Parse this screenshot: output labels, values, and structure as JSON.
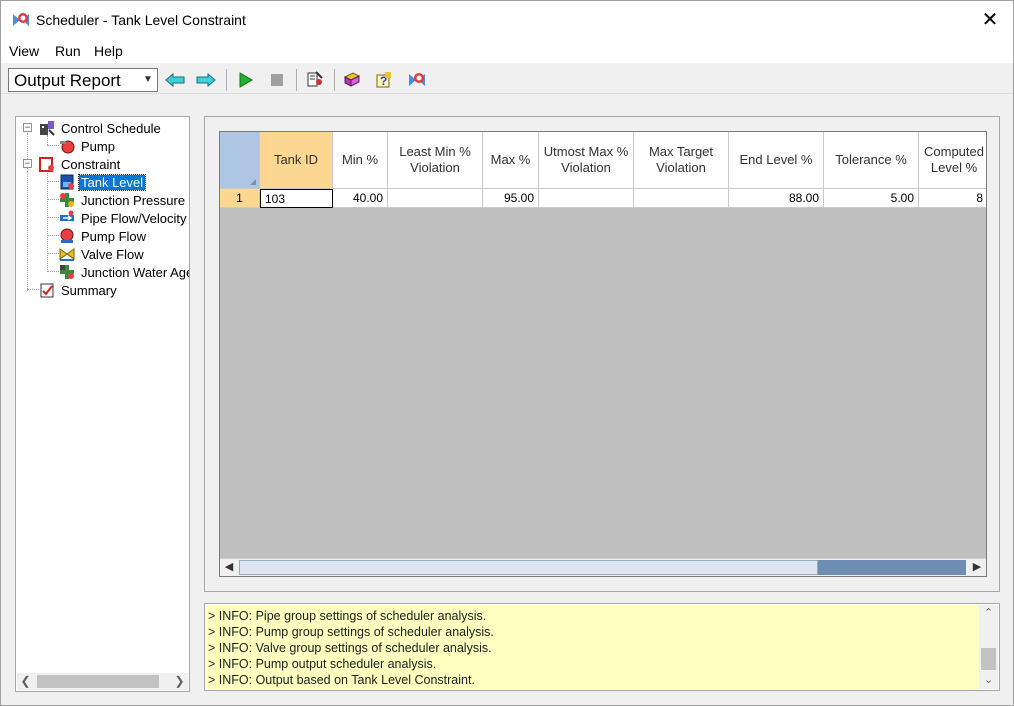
{
  "window": {
    "title": "Scheduler - Tank Level Constraint",
    "close_glyph": "✕"
  },
  "menu": {
    "items": [
      "View",
      "Run",
      "Help"
    ]
  },
  "toolbar": {
    "report_select": "Output Report",
    "icons": [
      "back-arrow-icon",
      "forward-arrow-icon",
      "run-icon",
      "stop-icon",
      "options-icon",
      "book-icon",
      "help-icon",
      "scheduler-icon"
    ]
  },
  "tree": {
    "items": [
      {
        "label": "Control Schedule",
        "icon": "control-schedule-icon"
      },
      {
        "label": "Pump",
        "icon": "pump-icon"
      },
      {
        "label": "Constraint",
        "icon": "constraint-icon"
      },
      {
        "label": "Tank Level",
        "icon": "tank-level-icon",
        "selected": true
      },
      {
        "label": "Junction Pressure",
        "icon": "junction-pressure-icon"
      },
      {
        "label": "Pipe Flow/Velocity",
        "icon": "pipe-flow-icon"
      },
      {
        "label": "Pump Flow",
        "icon": "pump-flow-icon"
      },
      {
        "label": "Valve Flow",
        "icon": "valve-flow-icon"
      },
      {
        "label": "Junction Water Age",
        "icon": "junction-water-age-icon"
      },
      {
        "label": "Summary",
        "icon": "summary-icon"
      }
    ]
  },
  "grid": {
    "columns": [
      "Tank ID",
      "Min %",
      "Least Min % Violation",
      "Max %",
      "Utmost Max % Violation",
      "Max Target Violation",
      "End Level %",
      "Tolerance %",
      "Computed Level %"
    ],
    "rows": [
      {
        "num": "1",
        "cells": [
          "103",
          "40.00",
          "",
          "95.00",
          "",
          "",
          "88.00",
          "5.00",
          "8"
        ]
      }
    ]
  },
  "log": {
    "lines": [
      "> INFO: Pipe group settings of scheduler analysis.",
      "> INFO: Pump group settings of scheduler analysis.",
      "> INFO: Valve group settings of scheduler analysis.",
      "> INFO: Pump output scheduler analysis.",
      "> INFO: Output based on Tank Level Constraint."
    ]
  },
  "colors": {
    "selection": "#0078d7",
    "active_header": "#fbd792",
    "log_background": "#ffffc0"
  }
}
